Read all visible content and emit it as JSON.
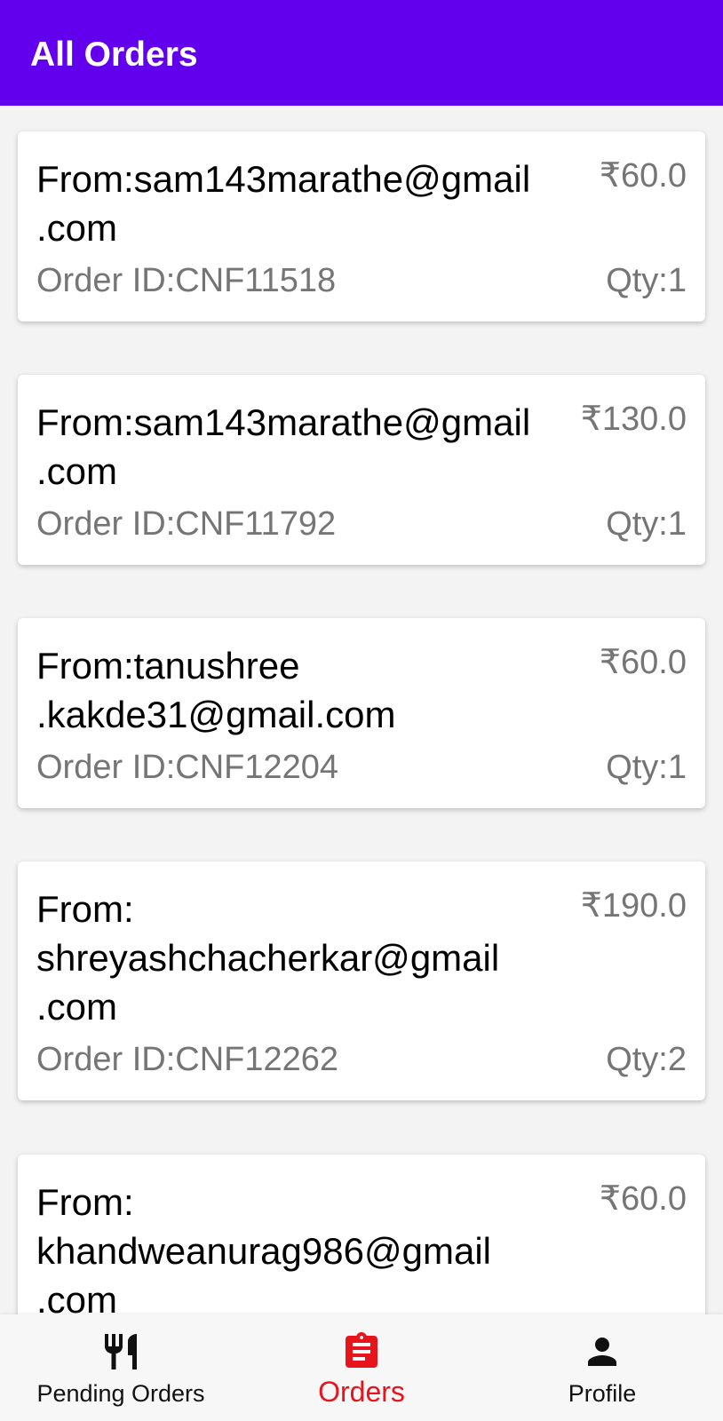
{
  "app_bar": {
    "title": "All Orders"
  },
  "orders": [
    {
      "from": "From:sam143marathe@gmail\n.com",
      "price": "₹60.0",
      "order_id": "Order ID:CNF11518",
      "qty": "Qty:1"
    },
    {
      "from": "From:sam143marathe@gmail\n.com",
      "price": "₹130.0",
      "order_id": "Order ID:CNF11792",
      "qty": "Qty:1"
    },
    {
      "from": "From:tanushree\n.kakde31@gmail.com",
      "price": "₹60.0",
      "order_id": "Order ID:CNF12204",
      "qty": "Qty:1"
    },
    {
      "from": "From:\nshreyashchacherkar@gmail\n.com",
      "price": "₹190.0",
      "order_id": "Order ID:CNF12262",
      "qty": "Qty:2"
    },
    {
      "from": "From:\nkhandweanurag986@gmail\n.com",
      "price": "₹60.0"
    }
  ],
  "bottom_nav": {
    "items": [
      {
        "label": "Pending Orders",
        "icon": "restaurant-icon",
        "active": false
      },
      {
        "label": "Orders",
        "icon": "assignment-icon",
        "active": true
      },
      {
        "label": "Profile",
        "icon": "person-icon",
        "active": false
      }
    ],
    "active_color": "#e8141b",
    "inactive_color": "#111111"
  },
  "colors": {
    "app_bar": "#6200ee",
    "secondary_text": "#757575"
  }
}
